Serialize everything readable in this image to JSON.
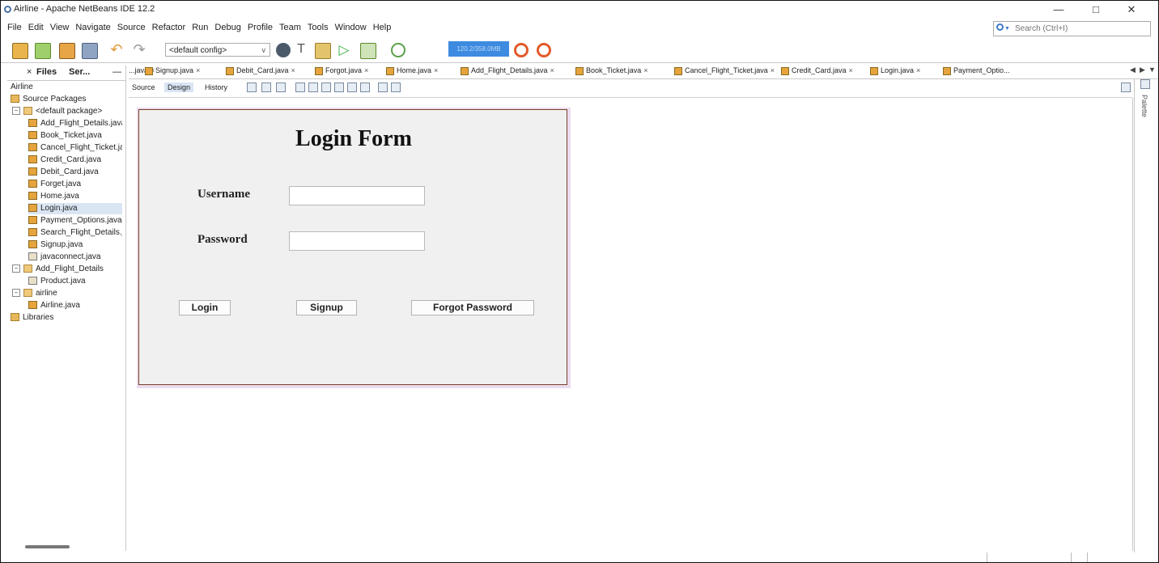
{
  "window": {
    "title": "Airline - Apache NetBeans IDE 12.2",
    "minimize_glyph": "—",
    "maximize_glyph": "□",
    "close_glyph": "✕"
  },
  "menu": [
    "File",
    "Edit",
    "View",
    "Navigate",
    "Source",
    "Refactor",
    "Run",
    "Debug",
    "Profile",
    "Team",
    "Tools",
    "Window",
    "Help"
  ],
  "search": {
    "placeholder": "Search (Ctrl+I)"
  },
  "toolbar": {
    "config": "<default config>",
    "memory": "120.2/358.0MB",
    "icons": [
      "new-project-icon",
      "new-file-icon",
      "open-project-icon",
      "save-all-icon",
      "undo-icon",
      "redo-icon",
      "globe-icon",
      "hammer-icon",
      "clean-build-icon",
      "run-icon",
      "debug-icon",
      "profile-icon",
      "gc-icon",
      "gc-profile-icon"
    ]
  },
  "left_panel": {
    "tabs": {
      "close": "×",
      "files": "Files",
      "services": "Ser...",
      "minimize": "—"
    },
    "tree": [
      {
        "label": "Airline",
        "indent": 0,
        "icon": "none"
      },
      {
        "label": "Source Packages",
        "indent": 0,
        "icon": "folder"
      },
      {
        "label": "<default package>",
        "indent": 1,
        "icon": "package",
        "expander": "−"
      },
      {
        "label": "Add_Flight_Details.java",
        "indent": 2,
        "icon": "java"
      },
      {
        "label": "Book_Ticket.java",
        "indent": 2,
        "icon": "java"
      },
      {
        "label": "Cancel_Flight_Ticket.java",
        "indent": 2,
        "icon": "java"
      },
      {
        "label": "Credit_Card.java",
        "indent": 2,
        "icon": "java"
      },
      {
        "label": "Debit_Card.java",
        "indent": 2,
        "icon": "java"
      },
      {
        "label": "Forget.java",
        "indent": 2,
        "icon": "java"
      },
      {
        "label": "Home.java",
        "indent": 2,
        "icon": "java"
      },
      {
        "label": "Login.java",
        "indent": 2,
        "icon": "java",
        "selected": true
      },
      {
        "label": "Payment_Options.java",
        "indent": 2,
        "icon": "java"
      },
      {
        "label": "Search_Flight_Details.java",
        "indent": 2,
        "icon": "java"
      },
      {
        "label": "Signup.java",
        "indent": 2,
        "icon": "java"
      },
      {
        "label": "javaconnect.java",
        "indent": 2,
        "icon": "java-plain"
      },
      {
        "label": "Add_Flight_Details",
        "indent": 1,
        "icon": "package",
        "expander": "−"
      },
      {
        "label": "Product.java",
        "indent": 2,
        "icon": "java-plain"
      },
      {
        "label": "airline",
        "indent": 1,
        "icon": "package",
        "expander": "−"
      },
      {
        "label": "Airline.java",
        "indent": 2,
        "icon": "java"
      },
      {
        "label": "Libraries",
        "indent": 0,
        "icon": "library"
      }
    ]
  },
  "editor_tabs": [
    {
      "label": "...java"
    },
    {
      "label": "Signup.java"
    },
    {
      "label": "Debit_Card.java"
    },
    {
      "label": "Forgot.java"
    },
    {
      "label": "Home.java"
    },
    {
      "label": "Add_Flight_Details.java"
    },
    {
      "label": "Book_Ticket.java"
    },
    {
      "label": "Cancel_Flight_Ticket.java"
    },
    {
      "label": "Credit_Card.java"
    },
    {
      "label": "Login.java",
      "active": true
    },
    {
      "label": "Payment_Optio..."
    }
  ],
  "editor_subtabs": {
    "source": "Source",
    "design": "Design",
    "history": "History"
  },
  "palette_label": "Palette",
  "form": {
    "title": "Login Form",
    "username_label": "Username",
    "password_label": "Password",
    "username_value": "",
    "password_value": "",
    "login_button": "Login",
    "signup_button": "Signup",
    "forgot_button": "Forgot Password"
  },
  "colors": {
    "memory_bar": "#3d8be0",
    "form_border": "#7a3f28",
    "form_background": "#f0f0f0",
    "selection": "#d9e5f3"
  }
}
